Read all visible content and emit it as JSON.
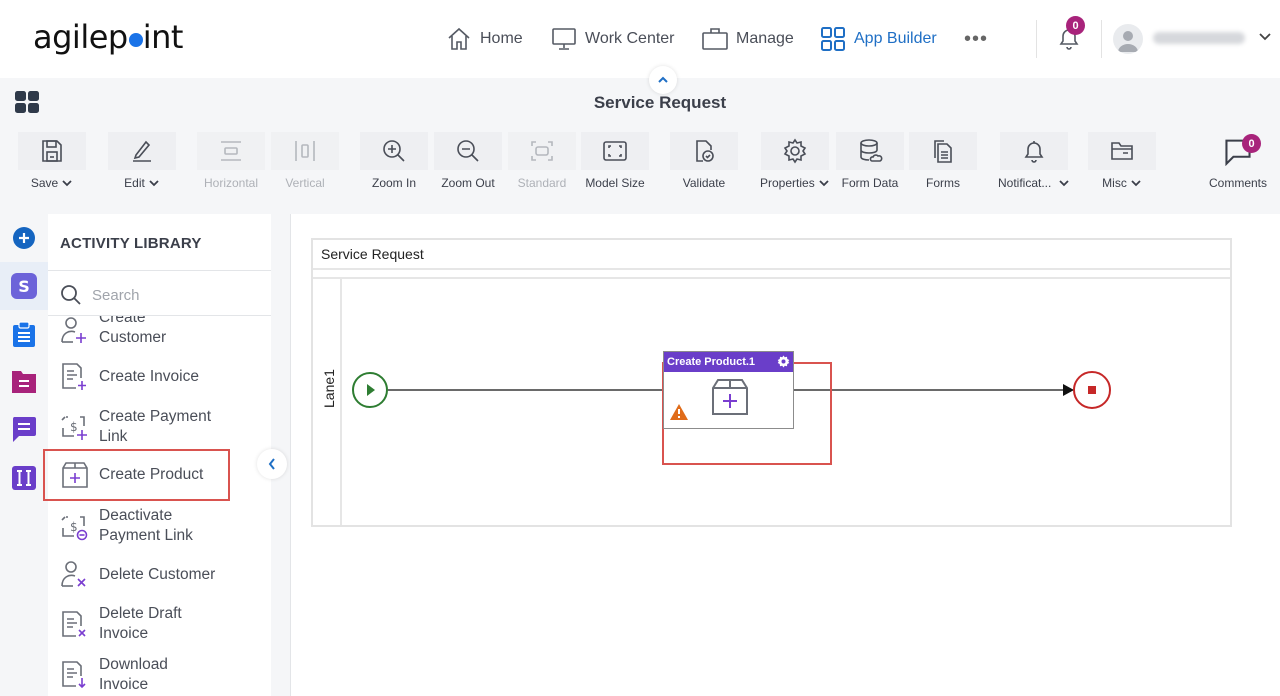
{
  "header": {
    "logo_text_a": "agilep",
    "logo_text_b": "int",
    "nav": [
      {
        "label": "Home",
        "icon": "home-icon"
      },
      {
        "label": "Work Center",
        "icon": "monitor-icon"
      },
      {
        "label": "Manage",
        "icon": "briefcase-icon"
      },
      {
        "label": "App Builder",
        "icon": "grid-icon",
        "active": true
      }
    ],
    "more_label": "•••",
    "notifications_count": "0",
    "user_name": "(blurred)",
    "accent_color": "#1f6fc5",
    "badge_color": "#a8237b"
  },
  "title_bar": {
    "title": "Service Request"
  },
  "toolbar": {
    "items": [
      {
        "label": "Save",
        "dropdown": true,
        "enabled": true
      },
      {
        "label": "Edit",
        "dropdown": true,
        "enabled": true
      },
      {
        "label": "Horizontal",
        "enabled": false
      },
      {
        "label": "Vertical",
        "enabled": false
      },
      {
        "label": "Zoom In",
        "enabled": true
      },
      {
        "label": "Zoom Out",
        "enabled": true
      },
      {
        "label": "Standard",
        "enabled": false
      },
      {
        "label": "Model Size",
        "enabled": true
      },
      {
        "label": "Validate",
        "enabled": true
      },
      {
        "label": "Properties",
        "dropdown": true,
        "enabled": true
      },
      {
        "label": "Form Data",
        "enabled": true
      },
      {
        "label": "Forms",
        "enabled": true
      },
      {
        "label": "Notificat...",
        "dropdown": true,
        "enabled": true
      },
      {
        "label": "Misc",
        "dropdown": true,
        "enabled": true
      },
      {
        "label": "Comments",
        "enabled": true
      }
    ],
    "comments_count": "0"
  },
  "left_rail": {
    "items": [
      {
        "name": "add",
        "color": "#1565c0"
      },
      {
        "name": "stripe",
        "color": "#6c63d9",
        "active": true
      },
      {
        "name": "clipboard",
        "color": "#1a73e8"
      },
      {
        "name": "folder",
        "color": "#a8237b"
      },
      {
        "name": "chat",
        "color": "#6a3ec9"
      },
      {
        "name": "text",
        "color": "#6a3ec9"
      }
    ]
  },
  "activity_library": {
    "title": "ACTIVITY LIBRARY",
    "search_placeholder": "Search",
    "items": [
      {
        "label": "Create Customer",
        "line1": "Create",
        "line2": "Customer"
      },
      {
        "label": "Create Invoice",
        "line1": "Create Invoice",
        "line2": ""
      },
      {
        "label": "Create Payment Link",
        "line1": "Create Payment",
        "line2": "Link"
      },
      {
        "label": "Create Product",
        "line1": "Create Product",
        "line2": "",
        "highlighted": true
      },
      {
        "label": "Deactivate Payment Link",
        "line1": "Deactivate",
        "line2": "Payment Link"
      },
      {
        "label": "Delete Customer",
        "line1": "Delete Customer",
        "line2": ""
      },
      {
        "label": "Delete Draft Invoice",
        "line1": "Delete Draft",
        "line2": "Invoice"
      },
      {
        "label": "Download Invoice",
        "line1": "Download",
        "line2": "Invoice"
      }
    ]
  },
  "canvas": {
    "pool_title": "Service Request",
    "lane_label": "Lane1",
    "task_title": "Create Product.1",
    "task_color": "#6a3ec9",
    "start_color": "#2e7d32",
    "end_color": "#c62828",
    "warning_color": "#e06c1a"
  }
}
